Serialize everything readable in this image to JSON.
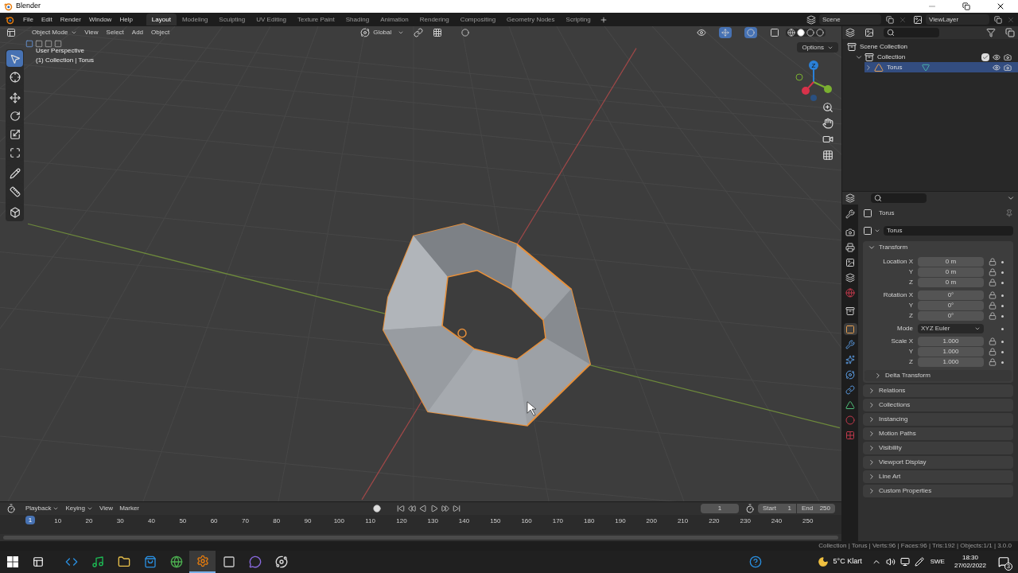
{
  "window": {
    "title": "Blender"
  },
  "menu": [
    "File",
    "Edit",
    "Render",
    "Window",
    "Help"
  ],
  "workspaces": [
    {
      "label": "Layout",
      "selected": true
    },
    {
      "label": "Modeling",
      "selected": false
    },
    {
      "label": "Sculpting",
      "selected": false
    },
    {
      "label": "UV Editing",
      "selected": false
    },
    {
      "label": "Texture Paint",
      "selected": false
    },
    {
      "label": "Shading",
      "selected": false
    },
    {
      "label": "Animation",
      "selected": false
    },
    {
      "label": "Rendering",
      "selected": false
    },
    {
      "label": "Compositing",
      "selected": false
    },
    {
      "label": "Geometry Nodes",
      "selected": false
    },
    {
      "label": "Scripting",
      "selected": false
    }
  ],
  "scene": "Scene",
  "view_layer": "ViewLayer",
  "viewport": {
    "mode": "Object Mode",
    "menus": [
      "View",
      "Select",
      "Add",
      "Object"
    ],
    "orientation": "Global",
    "options": "Options",
    "info": [
      "User Perspective",
      "(1) Collection | Torus"
    ],
    "gizmo_label": "Z",
    "tools": [
      {
        "kind": "select",
        "selected": true
      },
      {
        "kind": "cursor",
        "selected": false
      },
      {
        "kind": "move",
        "selected": false
      },
      {
        "kind": "rotate",
        "selected": false
      },
      {
        "kind": "scale",
        "selected": false
      },
      {
        "kind": "transform",
        "selected": false
      },
      {
        "kind": "annotate",
        "selected": false
      },
      {
        "kind": "measure",
        "selected": false
      },
      {
        "kind": "add-cube",
        "selected": false
      }
    ]
  },
  "outliner": {
    "items": [
      {
        "label": "Scene Collection",
        "kind": "scene",
        "selected": false,
        "children": [
          {
            "label": "Collection",
            "kind": "collection",
            "selected": false,
            "expanded": true,
            "checked": true,
            "children": [
              {
                "label": "Torus",
                "kind": "object",
                "selected": true,
                "expanded": false
              }
            ]
          }
        ]
      }
    ]
  },
  "properties": {
    "tabs": [
      {
        "kind": "tool",
        "selected": false
      },
      {
        "kind": "render",
        "selected": false
      },
      {
        "kind": "output",
        "selected": false
      },
      {
        "kind": "view-layer",
        "selected": false
      },
      {
        "kind": "scene",
        "selected": false
      },
      {
        "kind": "world",
        "selected": false
      },
      {
        "kind": "collection",
        "selected": false
      },
      {
        "kind": "object",
        "selected": true
      },
      {
        "kind": "modifiers",
        "selected": false
      },
      {
        "kind": "particles",
        "selected": false
      },
      {
        "kind": "physics",
        "selected": false
      },
      {
        "kind": "constraints",
        "selected": false
      },
      {
        "kind": "data",
        "selected": false
      },
      {
        "kind": "material",
        "selected": false
      },
      {
        "kind": "texture",
        "selected": false
      }
    ],
    "object_title": "Torus",
    "object_name": "Torus",
    "transform": {
      "title": "Transform",
      "expanded": true,
      "groups": [
        [
          {
            "kind": "number",
            "label": "Location X",
            "value": "0 m"
          },
          {
            "kind": "number",
            "label": "Y",
            "value": "0 m"
          },
          {
            "kind": "number",
            "label": "Z",
            "value": "0 m"
          }
        ],
        [
          {
            "kind": "number",
            "label": "Rotation X",
            "value": "0°"
          },
          {
            "kind": "number",
            "label": "Y",
            "value": "0°"
          },
          {
            "kind": "number",
            "label": "Z",
            "value": "0°"
          }
        ],
        [
          {
            "kind": "dropdown",
            "label": "Mode",
            "value": "XYZ Euler"
          }
        ],
        [
          {
            "kind": "number",
            "label": "Scale X",
            "value": "1.000"
          },
          {
            "kind": "number",
            "label": "Y",
            "value": "1.000"
          },
          {
            "kind": "number",
            "label": "Z",
            "value": "1.000"
          }
        ]
      ],
      "subpanels": [
        {
          "label": "Delta Transform",
          "expanded": false
        }
      ]
    },
    "panels": [
      {
        "label": "Relations",
        "expanded": false
      },
      {
        "label": "Collections",
        "expanded": false
      },
      {
        "label": "Instancing",
        "expanded": false
      },
      {
        "label": "Motion Paths",
        "expanded": false
      },
      {
        "label": "Visibility",
        "expanded": false
      },
      {
        "label": "Viewport Display",
        "expanded": false
      },
      {
        "label": "Line Art",
        "expanded": false
      },
      {
        "label": "Custom Properties",
        "expanded": false
      }
    ]
  },
  "timeline": {
    "menus": [
      "Playback",
      "Keying",
      "View",
      "Marker"
    ],
    "current_frame": "1",
    "start_label": "Start",
    "start": "1",
    "end_label": "End",
    "end": "250",
    "playhead": "1",
    "ticks": [
      "10",
      "20",
      "30",
      "40",
      "50",
      "60",
      "70",
      "80",
      "90",
      "100",
      "110",
      "120",
      "130",
      "140",
      "150",
      "160",
      "170",
      "180",
      "190",
      "200",
      "210",
      "220",
      "230",
      "240",
      "250"
    ]
  },
  "status_bar": "Collection | Torus | Verts:96 | Faces:96 | Tris:192 | Objects:1/1 | 3.0.0",
  "taskbar": {
    "apps": [
      {
        "kind": "vscode",
        "active": false
      },
      {
        "kind": "spotify",
        "active": false
      },
      {
        "kind": "files",
        "active": false
      },
      {
        "kind": "store",
        "active": false
      },
      {
        "kind": "chrome",
        "active": false
      },
      {
        "kind": "blender",
        "active": true
      },
      {
        "kind": "window",
        "active": false
      },
      {
        "kind": "chat",
        "active": false
      },
      {
        "kind": "app",
        "active": false
      }
    ],
    "weather": "5°C Klart",
    "language": "SWE",
    "time": "18:30",
    "date": "27/02/2022",
    "notifications": "3"
  }
}
